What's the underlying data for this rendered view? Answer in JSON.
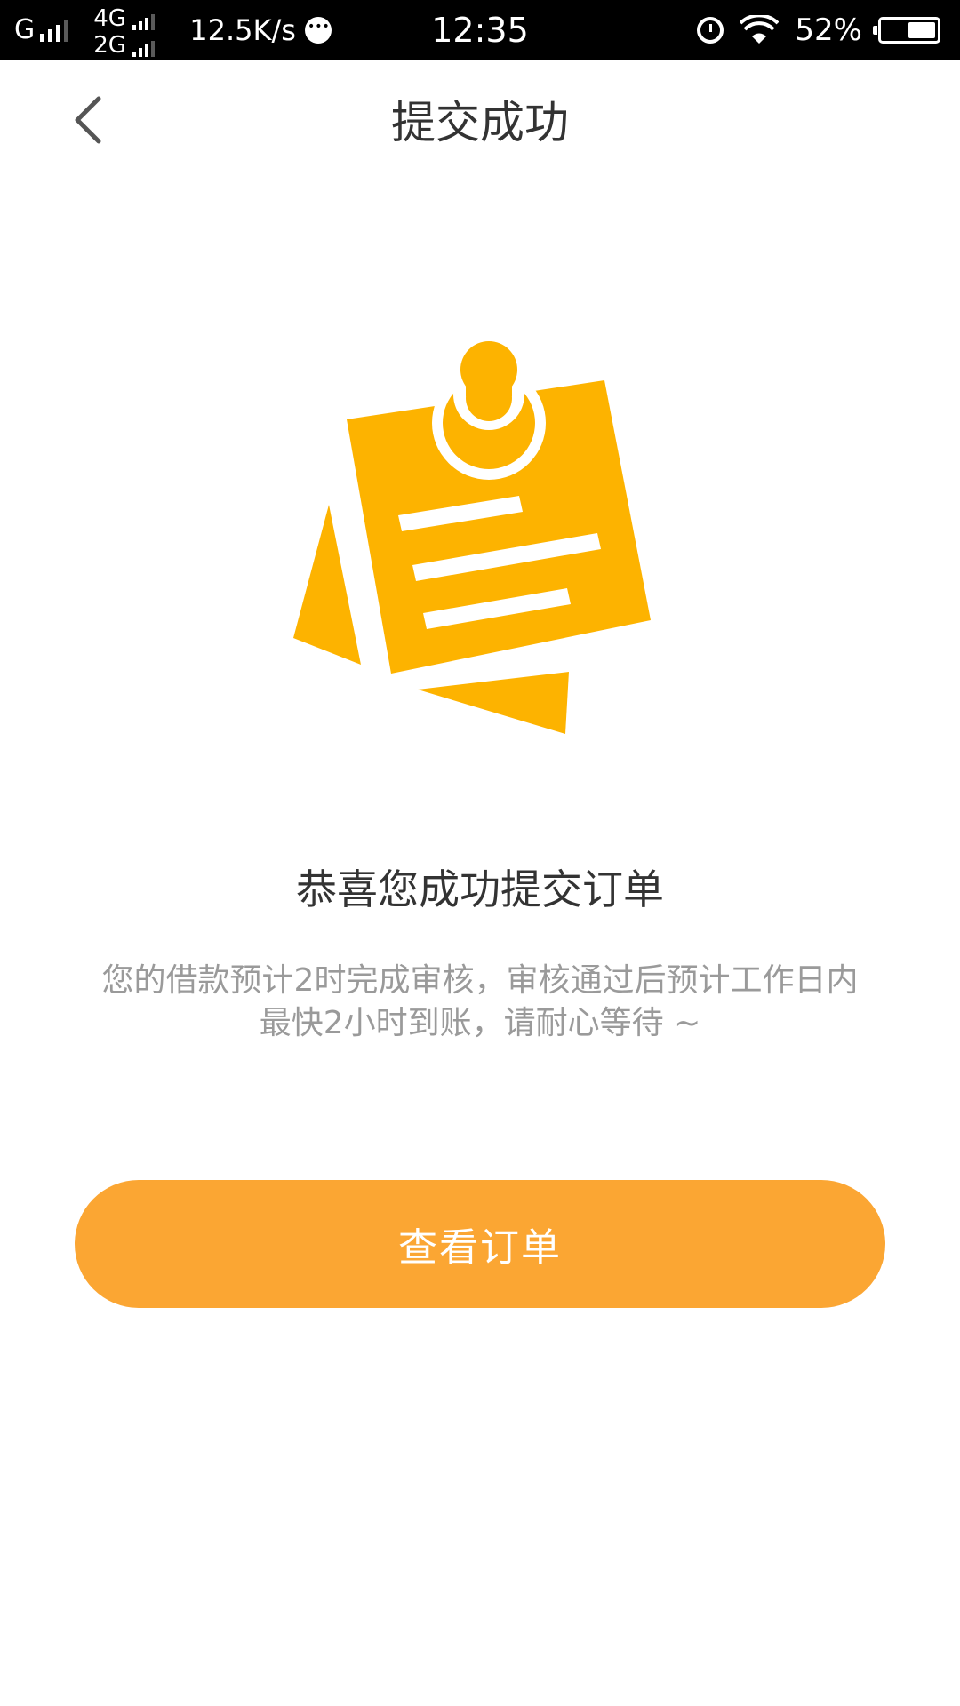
{
  "status_bar": {
    "network_primary": "G",
    "sim1_label": "4G",
    "sim2_label": "2G",
    "net_speed": "12.5K/s",
    "time": "12:35",
    "battery_percent": "52%",
    "battery_level": 0.52
  },
  "nav": {
    "back_icon": "chevron-left-icon",
    "title": "提交成功"
  },
  "illustration": {
    "icon": "pinned-note-icon",
    "color": "#FDB300"
  },
  "content": {
    "title": "恭喜您成功提交订单",
    "description": "您的借款预计2时完成审核，审核通过后预计工作日内最快2小时到账，请耐心等待 ~"
  },
  "actions": {
    "view_order_label": "查看订单",
    "button_color": "#FBA633"
  }
}
